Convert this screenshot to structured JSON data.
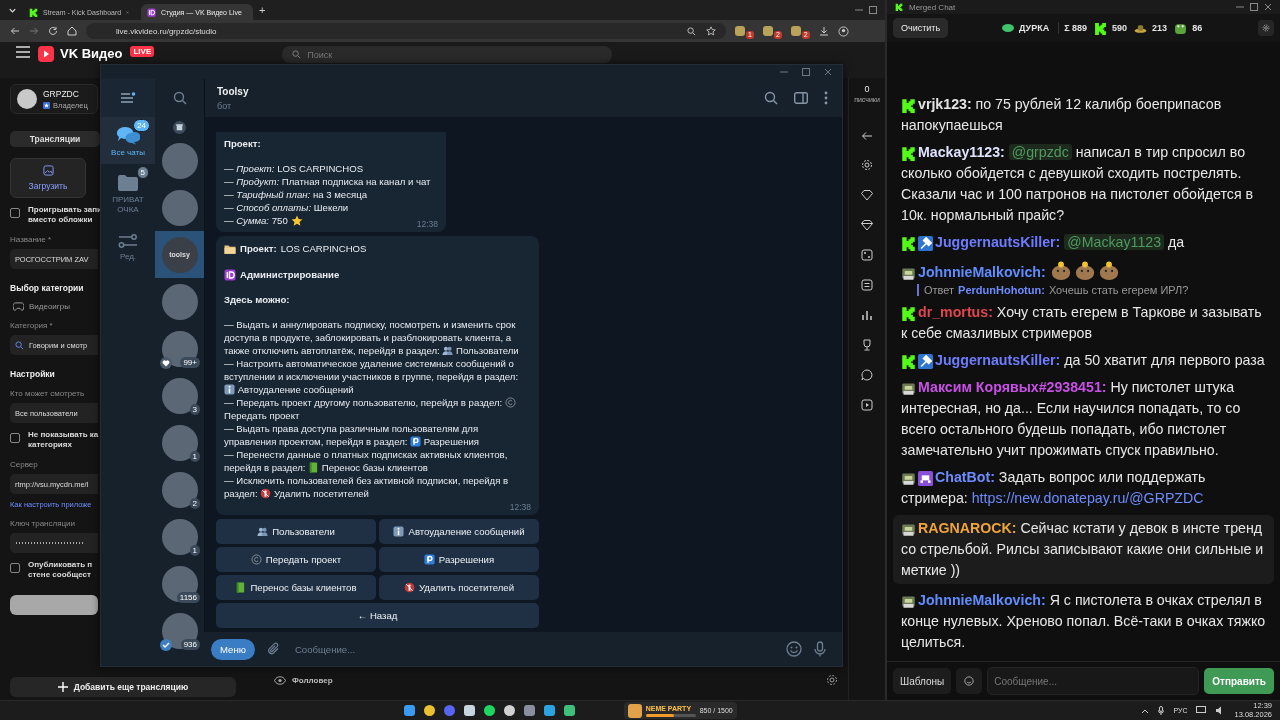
{
  "browser": {
    "tabs": [
      {
        "title": "Stream - Kick Dashboard",
        "kind": "kick",
        "selected": false
      },
      {
        "title": "Студия — VK Видео Live",
        "kind": "vk",
        "selected": true
      }
    ],
    "new_tab": "+",
    "url": "live.vkvideo.ru/grpzdc/studio",
    "extension_badges": [
      "1",
      "2",
      "2"
    ]
  },
  "vk": {
    "logo": "VK Видео",
    "logo_badge": "LIVE",
    "search_placeholder": "Поиск",
    "profile": {
      "name": "GRPZDC",
      "role": "Владелец"
    },
    "stat": {
      "value": "0",
      "label": "писчики"
    },
    "tab": "Трансляции",
    "upload": "Загрузить",
    "form": [
      {
        "kind": "checkbox",
        "lines": [
          "Проигрывать запи",
          "вместо обложки"
        ],
        "checked": false
      },
      {
        "kind": "label",
        "text": "Название *"
      },
      {
        "kind": "field",
        "value": "РОСГОССТРИМ ZAV"
      },
      {
        "kind": "heading",
        "text": "Выбор категории"
      },
      {
        "kind": "chip",
        "text": "Видеоигры"
      },
      {
        "kind": "label",
        "text": "Категория *"
      },
      {
        "kind": "search",
        "value": "Говорим и смотр"
      },
      {
        "kind": "heading",
        "text": "Настройки"
      },
      {
        "kind": "label",
        "text": "Кто может смотреть"
      },
      {
        "kind": "field",
        "value": "Все пользователи"
      },
      {
        "kind": "checkbox",
        "lines": [
          "Не показывать ка",
          "категориях"
        ],
        "checked": false
      },
      {
        "kind": "label",
        "text": "Сервер"
      },
      {
        "kind": "field",
        "value": "rtmp://vsu.mycdn.me/l"
      },
      {
        "kind": "link",
        "text": "Как настроить приложе"
      },
      {
        "kind": "label",
        "text": "Ключ трансляции"
      },
      {
        "kind": "secret"
      },
      {
        "kind": "checkbox",
        "lines": [
          "Опубликовать п",
          "стене сообщест"
        ],
        "checked": false
      },
      {
        "kind": "blank"
      }
    ],
    "add_button": "Добавить еще трансляцию",
    "follower": "Фолловер"
  },
  "telegram": {
    "folders": [
      {
        "label": "Все чаты",
        "badge": "24",
        "kind": "chats",
        "selected": true
      },
      {
        "label": "ПРИВАТ ОЧКА",
        "badge": "5",
        "kind": "folder",
        "selected": false
      },
      {
        "label": "Ред.",
        "kind": "edit",
        "selected": false
      }
    ],
    "chats": [
      {
        "kind": "plain",
        "selected": false
      },
      {
        "kind": "plain",
        "selected": false
      },
      {
        "kind": "plain",
        "selected": true,
        "label": "toolsy"
      },
      {
        "kind": "plain",
        "selected": false
      },
      {
        "kind": "heart",
        "selected": false,
        "badge": "99+"
      },
      {
        "kind": "plain",
        "selected": false,
        "badge": "3"
      },
      {
        "kind": "plain",
        "selected": false,
        "badge": "1"
      },
      {
        "kind": "plain",
        "selected": false,
        "badge": "2"
      },
      {
        "kind": "plain",
        "selected": false,
        "badge": "1"
      },
      {
        "kind": "plain",
        "selected": false,
        "badge": "1156"
      },
      {
        "kind": "verified",
        "selected": false,
        "badge": "936"
      }
    ],
    "chat_title": "Toolsy",
    "chat_subtitle": "бот",
    "order_message": {
      "heading": "Проект:",
      "lines": [
        {
          "kind": "plain",
          "text": "— *Проект:* LOS CARPINCHOS"
        },
        {
          "kind": "plain",
          "text": "— *Продукт:* Платная подписка на канал и чат"
        },
        {
          "kind": "plain",
          "text": "— *Тарифный план:* на 3 месяца"
        },
        {
          "kind": "plain",
          "text": "— *Способ оплаты:* Шекели"
        },
        {
          "kind": "star",
          "text": "— *Сумма:* 750"
        }
      ],
      "time": "12:38"
    },
    "admin_message": {
      "project_label": "Проект:",
      "project": "LOS CARPINCHOS",
      "title": "Администрирование",
      "intro": "Здесь можно:",
      "items": [
        {
          "kind": "users",
          "text": "— Выдать и аннулировать подписку, посмотреть и изменить срок доступа в продукте, заблокировать и разблокировать клиента, а также отключить автоплатёж, перейдя в раздел:",
          "section": "Пользователи"
        },
        {
          "kind": "info",
          "text": "— Настроить автоматическое удаление системных сообщений о вступлении и исключении участников в группе, перейдя в раздел:",
          "section": "Автоудаление сообщений"
        },
        {
          "kind": "transfer",
          "text": "— Передать проект другому пользователю, перейдя в раздел:",
          "section": "Передать проект"
        },
        {
          "kind": "permissions",
          "text": "— Выдать права доступа различным пользователям для управления проектом, перейдя в раздел:",
          "section": "Разрешения"
        },
        {
          "kind": "migrate",
          "text": "— Перенести данные о платных подписках активных клиентов, перейдя в раздел:",
          "section": "Перенос базы клиентов"
        },
        {
          "kind": "remove",
          "text": "— Исключить пользователей без активной подписки, перейдя в раздел:",
          "section": "Удалить посетителей"
        }
      ],
      "time": "12:38"
    },
    "keyboard": [
      {
        "kind": "users",
        "label": "Пользователи",
        "wide": false
      },
      {
        "kind": "info",
        "label": "Автоудаление сообщений",
        "wide": false
      },
      {
        "kind": "transfer",
        "label": "Передать проект",
        "wide": false
      },
      {
        "kind": "permissions",
        "label": "Разрешения",
        "wide": false
      },
      {
        "kind": "migrate",
        "label": "Перенос базы клиентов",
        "wide": false
      },
      {
        "kind": "remove",
        "label": "Удалить посетителей",
        "wide": false
      },
      {
        "kind": "back",
        "label": "← Назад",
        "wide": true
      }
    ],
    "menu_button": "Меню",
    "input_placeholder": "Сообщение..."
  },
  "merged_chat": {
    "title": "Merged Chat",
    "clear": "Очистить",
    "channel": "ДУРКА",
    "live": true,
    "total": "Σ 889",
    "counts": [
      {
        "kind": "kick",
        "value": "590"
      },
      {
        "kind": "hat",
        "value": "213"
      },
      {
        "kind": "frog",
        "value": "86"
      }
    ],
    "messages": [
      {
        "kind": "kick",
        "user": "vrjk123:",
        "color": "#e4e4e4",
        "text": "по 75 рублей 12 калибр боеприпасов напокупаешься",
        "highlighted": false
      },
      {
        "kind": "kick",
        "user": "Mackay1123:",
        "color": "#dfe3ff",
        "mention": "@grpzdc",
        "text": "написал в тир спросил во сколько обойдется с девушкой сходить пострелять. Сказали час и 100 патронов на пистолет обойдется в 10к. нормальный прайс?",
        "highlighted": false
      },
      {
        "kind": "kickmod",
        "user": "JuggernautsKiller:",
        "color": "#6e7dff",
        "mention": "@Mackay1123",
        "text": "да",
        "highlighted": false
      },
      {
        "kind": "vk",
        "user": "JohnnieMalkovich:",
        "color": "#5f8dff",
        "emotes": [
          {
            "kind": "capybara"
          },
          {
            "kind": "capybara"
          },
          {
            "kind": "capybara"
          }
        ],
        "reply": {
          "label": "Ответ",
          "user": "PerdunHohotun:",
          "text": "Хочешь стать егерем ИРЛ?"
        },
        "highlighted": false
      },
      {
        "kind": "kick",
        "user": "dr_mortus:",
        "color": "#e0464e",
        "text": "Хочу стать егерем в Таркове и зазывать к себе смазливых стримеров",
        "highlighted": false
      },
      {
        "kind": "kickmod",
        "user": "JuggernautsKiller:",
        "color": "#6e7dff",
        "text": "да 50 хватит для первого раза",
        "highlighted": false
      },
      {
        "kind": "vk",
        "user": "Максим Корявых#2938451:",
        "color": "#c850e6",
        "text": "Ну пистолет штука интересная, но да... Если научился попадать, то со всего остального будешь попадать, ибо пистолет замечательно учит прожимать спуск правильно.",
        "highlighted": false
      },
      {
        "kind": "vkbot",
        "user": "ChatBot:",
        "color": "#6e8cff",
        "text": "Задать вопрос или поддержать стримера:",
        "link": "https://new.donatepay.ru/@GRPZDC",
        "highlighted": false
      },
      {
        "kind": "vk",
        "user": "RAGNAROCK:",
        "color": "#f0a43a",
        "text": "Сейчас кстати у девок в инсте тренд со стрельбой. Рилсы записывают какие они сильные и меткие ))",
        "highlighted": true
      },
      {
        "kind": "vk",
        "user": "JohnnieMalkovich:",
        "color": "#5f8dff",
        "text": "Я с пистолета в очках стрелял в конце нулевых. Хреново попал. Всё-таки в очках тяжко целиться.",
        "highlighted": false
      }
    ],
    "templates": "Шаблоны",
    "input_placeholder": "Сообщение...",
    "send": "Отправить"
  },
  "taskbar": {
    "apps": [
      {
        "kind": "windows"
      },
      {
        "kind": "chrome"
      },
      {
        "kind": "discord"
      },
      {
        "kind": "steam"
      },
      {
        "kind": "spotify"
      },
      {
        "kind": "recorder"
      },
      {
        "kind": "monitor"
      },
      {
        "kind": "telegram"
      },
      {
        "kind": "switch"
      }
    ],
    "widget": {
      "title": "NEME PARTY",
      "progress": "850 / 1500",
      "level": 0.57
    },
    "language": "РУС",
    "time": "12:39",
    "date": "13.08.2026"
  }
}
